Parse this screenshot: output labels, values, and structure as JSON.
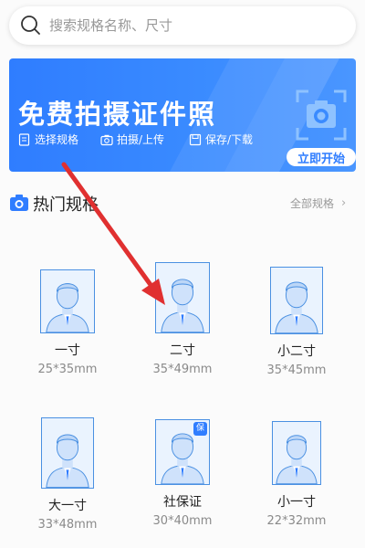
{
  "search": {
    "placeholder": "搜索规格名称、尺寸"
  },
  "banner": {
    "title": "免费拍摄证件照",
    "features": [
      "选择规格",
      "拍摄/上传",
      "保存/下载"
    ],
    "start_button": "立即开始"
  },
  "section": {
    "title": "热门规格",
    "all_link": "全部规格"
  },
  "specs": [
    {
      "name": "一寸",
      "size": "25*35mm"
    },
    {
      "name": "二寸",
      "size": "35*49mm"
    },
    {
      "name": "小二寸",
      "size": "35*45mm"
    },
    {
      "name": "大一寸",
      "size": "33*48mm"
    },
    {
      "name": "社保证",
      "size": "30*40mm",
      "badge": "保"
    },
    {
      "name": "小一寸",
      "size": "22*32mm"
    }
  ],
  "colors": {
    "accent": "#2f7dff",
    "annotation_arrow": "#e03030",
    "photo_border": "#4a90e2",
    "photo_bg": "#eaf3fe"
  }
}
